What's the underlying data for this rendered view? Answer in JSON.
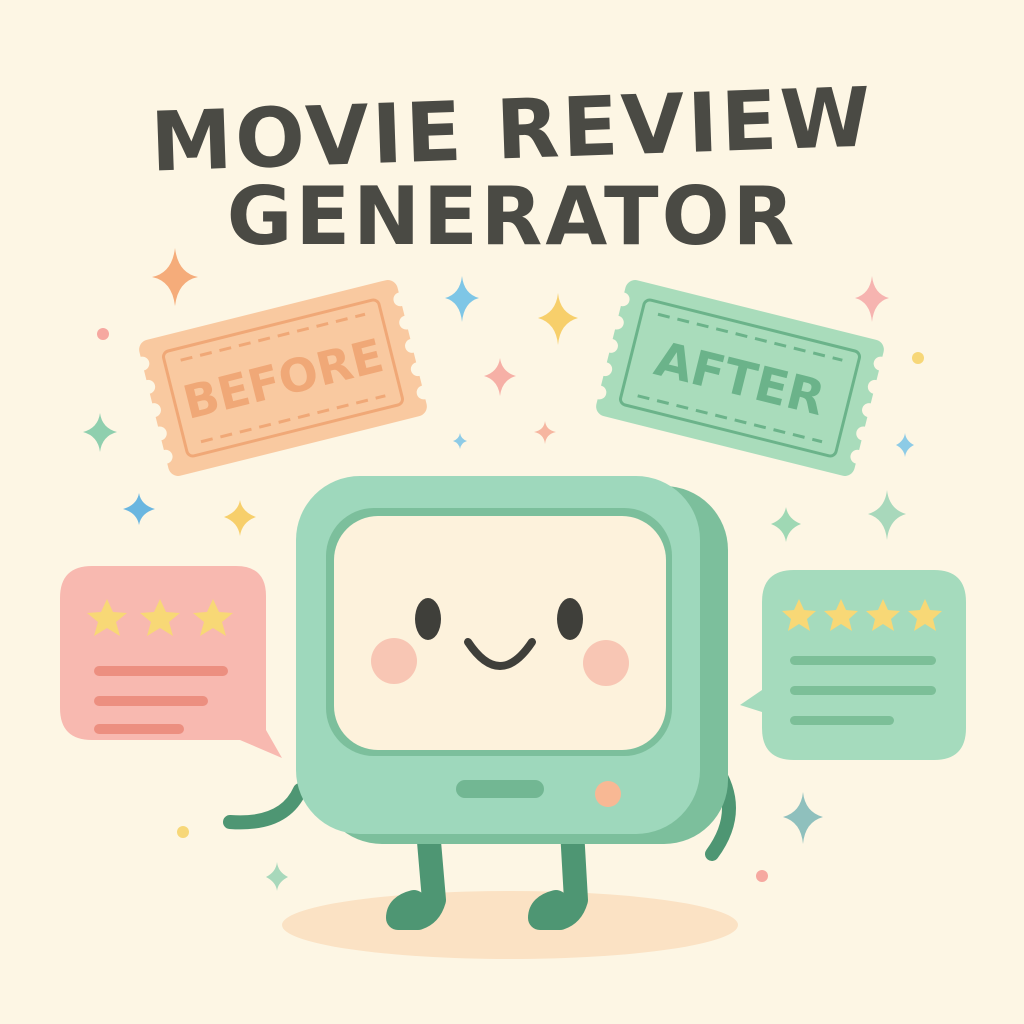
{
  "title": {
    "line1": "MOVIE REVIEW",
    "line2": "GENERATOR"
  },
  "tickets": {
    "before": {
      "label": "BEFORE",
      "color": "#f9c9a0",
      "text_color": "#f0a877"
    },
    "after": {
      "label": "AFTER",
      "color": "#a9dcbb",
      "text_color": "#6bb38a"
    }
  },
  "reviews": {
    "before": {
      "stars": 3,
      "bubble_color": "#f8b9b0",
      "line_color": "#ec8f80"
    },
    "after": {
      "stars": 4,
      "bubble_color": "#a5dbbd",
      "line_color": "#7cbf98"
    }
  },
  "mascot": {
    "body_color": "#9ed8bc",
    "screen_color": "#fdf2dc",
    "limb_color": "#4e9673"
  },
  "colors": {
    "background": "#fdf6e4",
    "star": "#f8d876"
  }
}
